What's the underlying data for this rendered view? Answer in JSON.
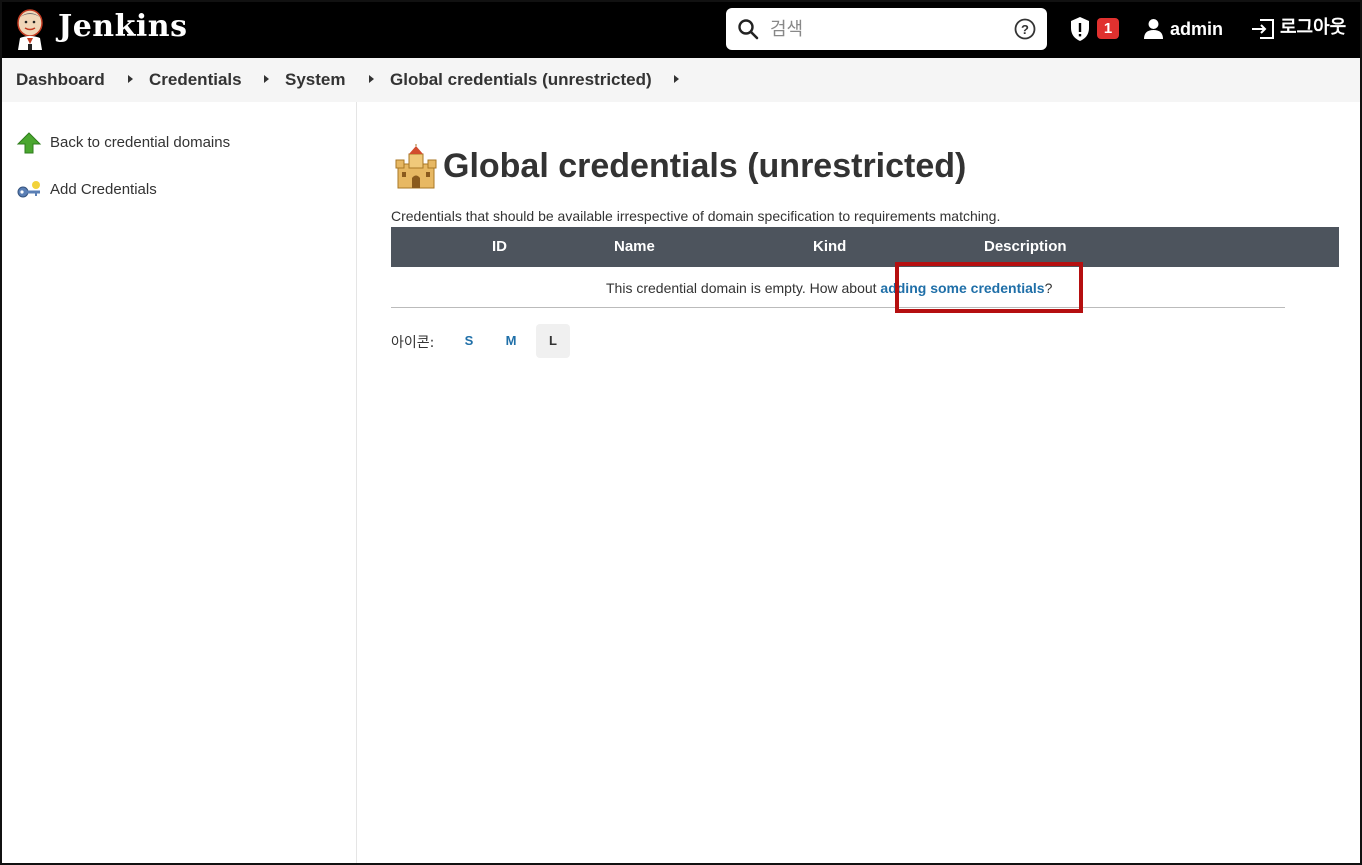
{
  "header": {
    "brand": "Jenkins",
    "search_placeholder": "검색",
    "security_badge_count": "1",
    "user_name": "admin",
    "logout_label": "로그아웃"
  },
  "breadcrumb": [
    "Dashboard",
    "Credentials",
    "System",
    "Global credentials (unrestricted)"
  ],
  "sidebar": {
    "items": [
      {
        "label": "Back to credential domains",
        "icon": "up-arrow-icon"
      },
      {
        "label": "Add Credentials",
        "icon": "key-icon"
      }
    ]
  },
  "main": {
    "title": "Global credentials (unrestricted)",
    "description": "Credentials that should be available irrespective of domain specification to requirements matching.",
    "table": {
      "columns": [
        "ID",
        "Name",
        "Kind",
        "Description"
      ],
      "empty_prefix": "This credential domain is empty. How about ",
      "empty_link": "adding some credentials",
      "empty_suffix": "?"
    },
    "icon_size": {
      "label": "아이콘:",
      "options": [
        "S",
        "M",
        "L"
      ],
      "selected": "L"
    }
  },
  "colors": {
    "header_bg": "#000000",
    "table_header_bg": "#4d545d",
    "link": "#1f6fa8",
    "badge": "#e0312f",
    "highlight": "#b50f10"
  }
}
